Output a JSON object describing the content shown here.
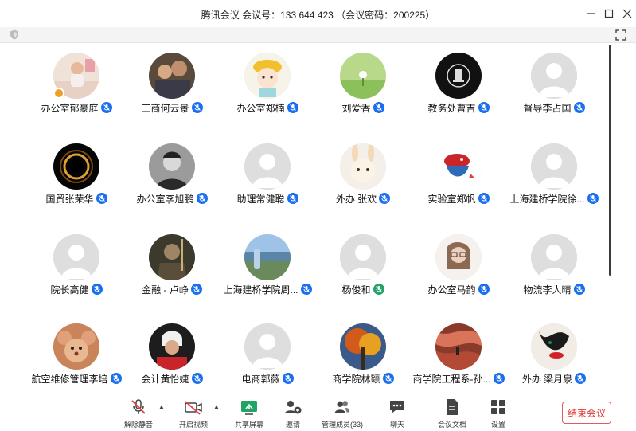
{
  "window": {
    "title": "腾讯会议  会议号：133 644 423 （会议密码：200225）"
  },
  "participants": [
    {
      "name": "办公室郁豪庭",
      "avatar": "photo-child-room",
      "mic": "blue",
      "host": true
    },
    {
      "name": "工商何云景",
      "avatar": "photo-family",
      "mic": "blue"
    },
    {
      "name": "办公室郑楠",
      "avatar": "cartoon-girl-yellow-hat",
      "mic": "blue"
    },
    {
      "name": "刘爱香",
      "avatar": "photo-green-field",
      "mic": "blue"
    },
    {
      "name": "教务处曹吉",
      "avatar": "logo-black-crest",
      "mic": "blue"
    },
    {
      "name": "督导李占国",
      "avatar": "default",
      "mic": "blue"
    },
    {
      "name": "国贸张荣华",
      "avatar": "photo-black-hole",
      "mic": "blue"
    },
    {
      "name": "办公室李旭鹏",
      "avatar": "photo-man-bw",
      "mic": "blue"
    },
    {
      "name": "助理常健聪",
      "avatar": "default",
      "mic": "blue"
    },
    {
      "name": "外办 张欢",
      "avatar": "cartoon-bunny",
      "mic": "blue"
    },
    {
      "name": "实验室郑帆",
      "avatar": "cartoon-bird",
      "mic": "blue"
    },
    {
      "name": "上海建桥学院徐...",
      "avatar": "default",
      "mic": "blue"
    },
    {
      "name": "院长高健",
      "avatar": "default",
      "mic": "blue"
    },
    {
      "name": "金融 - 卢峥",
      "avatar": "photo-warrior",
      "mic": "blue"
    },
    {
      "name": "上海建桥学院周...",
      "avatar": "photo-sea-person",
      "mic": "blue"
    },
    {
      "name": "杨俊和",
      "avatar": "default",
      "mic": "green"
    },
    {
      "name": "办公室马韵",
      "avatar": "photo-woman-glasses",
      "mic": "blue"
    },
    {
      "name": "物流李人晴",
      "avatar": "default",
      "mic": "blue"
    },
    {
      "name": "航空维修管理李培",
      "avatar": "cartoon-jerry-mouse",
      "mic": "blue"
    },
    {
      "name": "会计黄怡婕",
      "avatar": "photo-hockey-player",
      "mic": "blue"
    },
    {
      "name": "电商郭薇",
      "avatar": "default",
      "mic": "blue"
    },
    {
      "name": "商学院林颖",
      "avatar": "photo-autumn-tree",
      "mic": "blue"
    },
    {
      "name": "商学院工程系-孙...",
      "avatar": "photo-canyon",
      "mic": "blue"
    },
    {
      "name": "外办 梁月泉",
      "avatar": "art-red-lips",
      "mic": "blue"
    }
  ],
  "toolbar": {
    "unmute": "解除静音",
    "start_video": "开启视频",
    "share_screen": "共享屏幕",
    "invite": "邀请",
    "manage_members": "管理成员(33)",
    "chat": "聊天",
    "documents": "会议文档",
    "settings": "设置",
    "end_meeting": "结束会议"
  },
  "colors": {
    "mic_blue": "#1a6ef0",
    "mic_green": "#22a36a",
    "end_red": "#e23a3a",
    "share_green": "#1fa463"
  }
}
